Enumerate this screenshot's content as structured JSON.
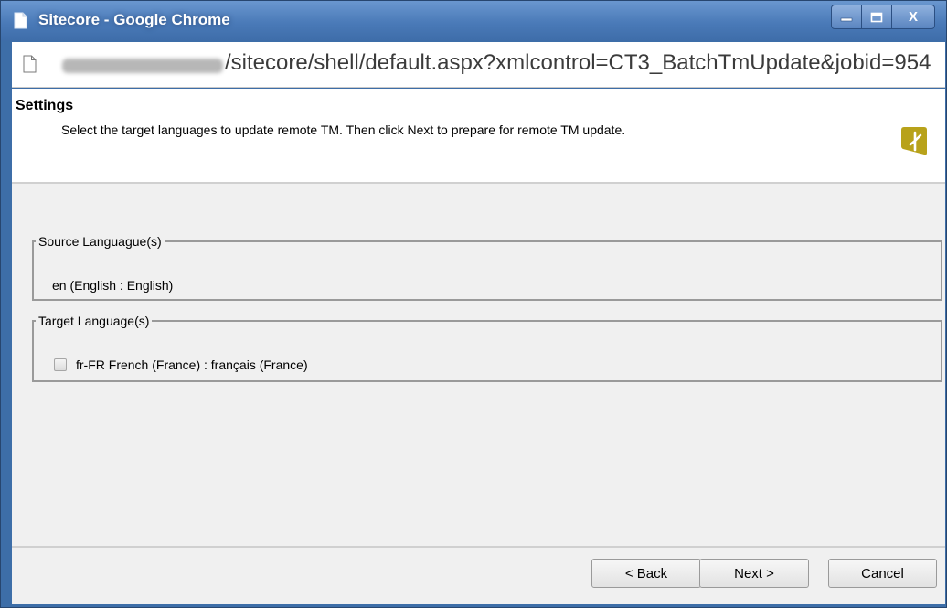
{
  "window": {
    "title": "Sitecore - Google Chrome",
    "controls": [
      "minimize",
      "maximize",
      "close"
    ],
    "close_glyph": "X"
  },
  "address_bar": {
    "url_visible": "/sitecore/shell/default.aspx?xmlcontrol=CT3_BatchTmUpdate&jobid=954"
  },
  "header": {
    "title": "Settings",
    "description": "Select the target languages to update remote TM. Then click Next to prepare for remote TM update."
  },
  "source_group": {
    "legend": "Source Languague(s)",
    "value": "en (English : English)"
  },
  "target_group": {
    "legend": "Target Language(s)",
    "languages": [
      {
        "label": "fr-FR French (France) : français (France)",
        "checked": false
      }
    ]
  },
  "buttons": {
    "back": "< Back",
    "next": "Next >",
    "cancel": "Cancel"
  },
  "colors": {
    "titlebar": "#4a7ab8",
    "logo": "#b8a21a",
    "dialog_bg": "#f0f0f0"
  }
}
